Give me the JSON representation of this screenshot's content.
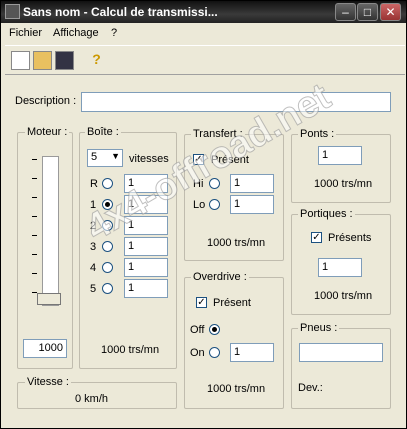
{
  "window": {
    "title": "Sans nom - Calcul de transmissi...",
    "min": "–",
    "max": "□",
    "close": "✕"
  },
  "menu": [
    "Fichier",
    "Affichage",
    "?"
  ],
  "toolbar": {
    "help": "?"
  },
  "description": {
    "label": "Description :",
    "value": ""
  },
  "moteur": {
    "label": "Moteur :",
    "value": "1000"
  },
  "boite": {
    "label": "Boîte :",
    "vitesses_value": "5",
    "vitesses_label": "vitesses",
    "gears": [
      {
        "label": "R",
        "value": "1",
        "selected": false
      },
      {
        "label": "1",
        "value": "1",
        "selected": true
      },
      {
        "label": "2",
        "value": "1",
        "selected": false
      },
      {
        "label": "3",
        "value": "1",
        "selected": false
      },
      {
        "label": "4",
        "value": "1",
        "selected": false
      },
      {
        "label": "5",
        "value": "1",
        "selected": false
      }
    ],
    "result": "1000 trs/mn"
  },
  "transfert": {
    "label": "Transfert :",
    "present_label": "Présent",
    "hi_label": "Hi",
    "hi_value": "1",
    "lo_label": "Lo",
    "lo_value": "1",
    "result": "1000 trs/mn"
  },
  "ponts": {
    "label": "Ponts :",
    "value": "1",
    "result": "1000 trs/mn"
  },
  "portiques": {
    "label": "Portiques :",
    "present_label": "Présents",
    "value": "1",
    "result": "1000 trs/mn"
  },
  "overdrive": {
    "label": "Overdrive :",
    "present_label": "Présent",
    "off_label": "Off",
    "on_label": "On",
    "on_value": "1",
    "result": "1000 trs/mn"
  },
  "pneus": {
    "label": "Pneus :",
    "value": "",
    "dev_label": "Dev.:"
  },
  "vitesse": {
    "label": "Vitesse :",
    "value": "0 km/h"
  },
  "watermark": "4x4-offroad.net"
}
